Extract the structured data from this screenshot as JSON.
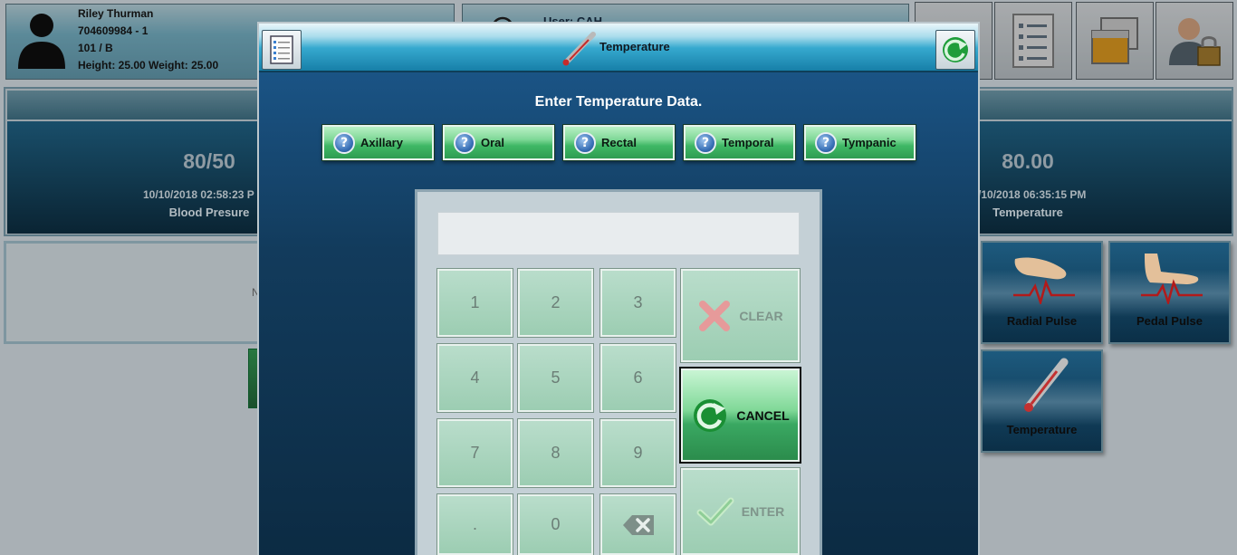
{
  "patient": {
    "name": "Riley Thurman",
    "id": "704609984 - 1",
    "room": "101 / B",
    "measurements": "Height: 25.00 Weight: 25.00"
  },
  "user": {
    "name": "User: CAH"
  },
  "top_buttons": [
    {
      "icon": "stethoscope-icon"
    },
    {
      "icon": "document-list-icon"
    },
    {
      "icon": "window-icon"
    },
    {
      "icon": "user-lock-icon"
    }
  ],
  "vitals": {
    "blood_pressure": {
      "value": "80/50",
      "time": "10/10/2018 02:58:23 P",
      "label": "Blood Presure"
    },
    "temperature": {
      "value": "80.00",
      "time": "/10/2018 06:35:15 PM",
      "label": "Temperature"
    }
  },
  "notes_placeholder": "N",
  "tiles": [
    {
      "label": "Radial Pulse",
      "icon": "radial-pulse-icon"
    },
    {
      "label": "Pedal Pulse",
      "icon": "pedal-pulse-icon"
    },
    {
      "label": "Temperature",
      "icon": "thermometer-icon"
    }
  ],
  "modal": {
    "title": "Temperature",
    "instruction": "Enter Temperature Data.",
    "routes": [
      "Axillary",
      "Oral",
      "Rectal",
      "Temporal",
      "Tympanic"
    ],
    "display_value": "",
    "keys": [
      "1",
      "2",
      "3",
      "4",
      "5",
      "6",
      "7",
      "8",
      "9",
      ".",
      "0"
    ],
    "clear_label": "CLEAR",
    "cancel_label": "CANCEL",
    "enter_label": "ENTER"
  },
  "colors": {
    "header_accent": "#36a9cf",
    "route_green": "#3fb865",
    "keypad_green": "#9ccdb2"
  }
}
